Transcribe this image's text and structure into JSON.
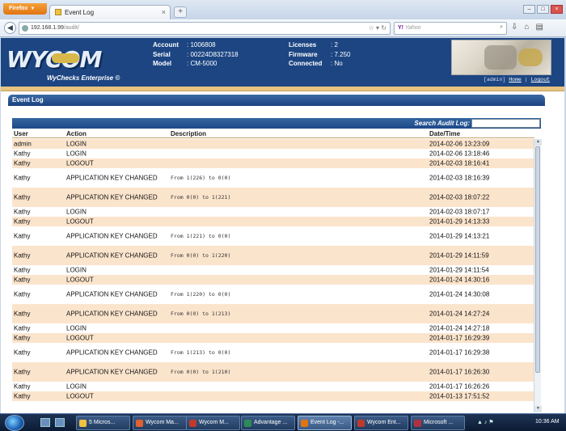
{
  "browser": {
    "app_button": "Firefox",
    "tab_title": "Event Log",
    "new_tab": "+",
    "url_host": "192.168.1.99",
    "url_path": "/audit/",
    "search_engine": "Y!",
    "search_placeholder": "Yahoo"
  },
  "header": {
    "logo_text": "WYCOM",
    "tagline": "WyChecks Enterprise ©",
    "account_label": "Account",
    "account_value": ": 1006808",
    "serial_label": "Serial",
    "serial_value": ": 00224D8327318",
    "model_label": "Model",
    "model_value": ": CM-5000",
    "licenses_label": "Licenses",
    "licenses_value": ": 2",
    "firmware_label": "Firmware",
    "firmware_value": ": 7.250",
    "connected_label": "Connected",
    "connected_value": ": No",
    "user_tag": "[admin]",
    "home_link": "Home",
    "separator": "|",
    "logout_link": "Logout"
  },
  "panel": {
    "title": "Event Log",
    "search_label": "Search Audit Log:",
    "search_value": ""
  },
  "table": {
    "columns": [
      "User",
      "Action",
      "Description",
      "Date/Time"
    ],
    "rows": [
      {
        "user": "admin",
        "action": "LOGIN",
        "description": "",
        "datetime": "2014-02-06 13:23:09"
      },
      {
        "user": "Kathy",
        "action": "LOGIN",
        "description": "",
        "datetime": "2014-02-06 13:18:46"
      },
      {
        "user": "Kathy",
        "action": "LOGOUT",
        "description": "",
        "datetime": "2014-02-03 18:16:41"
      },
      {
        "user": "Kathy",
        "action": "APPLICATION KEY CHANGED",
        "description": "From 1(226) to 0(0)",
        "datetime": "2014-02-03 18:16:39"
      },
      {
        "user": "Kathy",
        "action": "APPLICATION KEY CHANGED",
        "description": "From 0(0) to 1(221)",
        "datetime": "2014-02-03 18:07:22"
      },
      {
        "user": "Kathy",
        "action": "LOGIN",
        "description": "",
        "datetime": "2014-02-03 18:07:17"
      },
      {
        "user": "Kathy",
        "action": "LOGOUT",
        "description": "",
        "datetime": "2014-01-29 14:13:33"
      },
      {
        "user": "Kathy",
        "action": "APPLICATION KEY CHANGED",
        "description": "From 1(221) to 0(0)",
        "datetime": "2014-01-29 14:13:21"
      },
      {
        "user": "Kathy",
        "action": "APPLICATION KEY CHANGED",
        "description": "From 0(0) to 1(220)",
        "datetime": "2014-01-29 14:11:59"
      },
      {
        "user": "Kathy",
        "action": "LOGIN",
        "description": "",
        "datetime": "2014-01-29 14:11:54"
      },
      {
        "user": "Kathy",
        "action": "LOGOUT",
        "description": "",
        "datetime": "2014-01-24 14:30:16"
      },
      {
        "user": "Kathy",
        "action": "APPLICATION KEY CHANGED",
        "description": "From 1(220) to 0(0)",
        "datetime": "2014-01-24 14:30:08"
      },
      {
        "user": "Kathy",
        "action": "APPLICATION KEY CHANGED",
        "description": "From 0(0) to 1(213)",
        "datetime": "2014-01-24 14:27:24"
      },
      {
        "user": "Kathy",
        "action": "LOGIN",
        "description": "",
        "datetime": "2014-01-24 14:27:18"
      },
      {
        "user": "Kathy",
        "action": "LOGOUT",
        "description": "",
        "datetime": "2014-01-17 16:29:39"
      },
      {
        "user": "Kathy",
        "action": "APPLICATION KEY CHANGED",
        "description": "From 1(213) to 0(0)",
        "datetime": "2014-01-17 16:29:38"
      },
      {
        "user": "Kathy",
        "action": "APPLICATION KEY CHANGED",
        "description": "From 0(0) to 1(210)",
        "datetime": "2014-01-17 16:26:30"
      },
      {
        "user": "Kathy",
        "action": "LOGIN",
        "description": "",
        "datetime": "2014-01-17 16:26:26"
      },
      {
        "user": "Kathy",
        "action": "LOGOUT",
        "description": "",
        "datetime": "2014-01-13 17:51:52"
      }
    ]
  },
  "taskbar": {
    "buttons": [
      "5 Micros...",
      "Wycom Ma...",
      "Wycom M...",
      "Advantage ...",
      "Event Log -...",
      "Wycom Ent...",
      "Microsoft ..."
    ],
    "active_index": 4,
    "clock": "10:36 AM"
  },
  "colors": {
    "header_bg": "#1c4582",
    "row_alt": "#fbe4cc",
    "stripe": "#e6c37e"
  }
}
